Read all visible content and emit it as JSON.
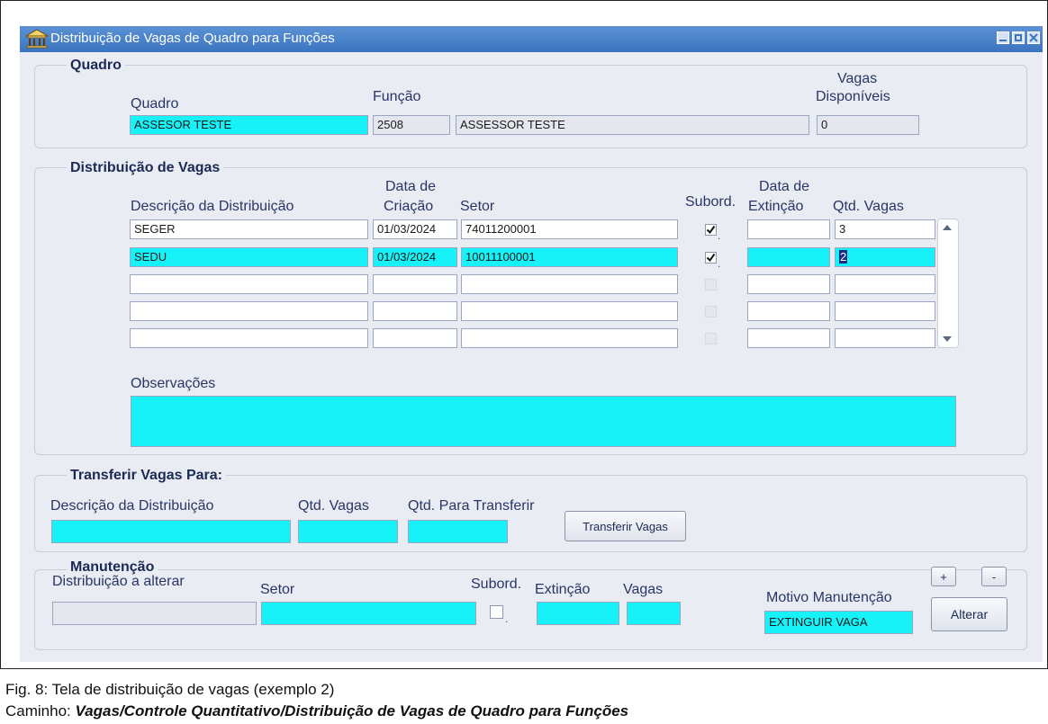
{
  "window": {
    "title": "Distribuição de Vagas de Quadro para Funções"
  },
  "quadro_group": {
    "title": "Quadro",
    "quadro_label": "Quadro",
    "funcao_label": "Função",
    "vagas_label_1": "Vagas",
    "vagas_label_2": "Disponíveis",
    "quadro_value": "ASSESOR TESTE",
    "funcao_code": "2508",
    "funcao_name": "ASSESSOR TESTE",
    "vagas_disponiveis": "0"
  },
  "distribuicao_group": {
    "title": "Distribuição de Vagas",
    "col_descricao": "Descrição da Distribuição",
    "col_data_criacao_1": "Data de",
    "col_data_criacao_2": "Criação",
    "col_setor": "Setor",
    "col_subord": "Subord.",
    "col_data_extincao_1": "Data de",
    "col_data_extincao_2": "Extinção",
    "col_qtd_vagas": "Qtd. Vagas",
    "rows": [
      {
        "descricao": "SEGER",
        "data_criacao": "01/03/2024",
        "setor": "74011200001",
        "subord": true,
        "data_extincao": "",
        "qtd_vagas": "3"
      },
      {
        "descricao": "SEDU",
        "data_criacao": "01/03/2024",
        "setor": "10011100001",
        "subord": true,
        "data_extincao": "",
        "qtd_vagas": "2"
      },
      {
        "descricao": "",
        "data_criacao": "",
        "setor": "",
        "subord": false,
        "data_extincao": "",
        "qtd_vagas": ""
      },
      {
        "descricao": "",
        "data_criacao": "",
        "setor": "",
        "subord": false,
        "data_extincao": "",
        "qtd_vagas": ""
      },
      {
        "descricao": "",
        "data_criacao": "",
        "setor": "",
        "subord": false,
        "data_extincao": "",
        "qtd_vagas": ""
      }
    ],
    "observacoes_label": "Observações",
    "observacoes_value": ""
  },
  "transferir_group": {
    "title": "Transferir Vagas Para:",
    "descricao_label": "Descrição da Distribuição",
    "qtd_vagas_label": "Qtd. Vagas",
    "qtd_transferir_label": "Qtd. Para Transferir",
    "button_label": "Transferir Vagas"
  },
  "manutencao_group": {
    "title": "Manutenção",
    "distribuicao_label": "Distribuição a alterar",
    "setor_label": "Setor",
    "subord_label": "Subord.",
    "extincao_label": "Extinção",
    "vagas_label": "Vagas",
    "motivo_label": "Motivo Manutenção",
    "motivo_value": "EXTINGUIR VAGA",
    "plus_label": "+",
    "minus_label": "-",
    "alterar_label": "Alterar"
  },
  "caption": {
    "line1": "Fig. 8: Tela de distribuição de vagas (exemplo 2)",
    "line2_prefix": "Caminho: ",
    "line2_path": "Vagas/Controle Quantitativo/Distribuição de Vagas de Quadro para Funções"
  },
  "colors": {
    "field_highlight": "#16f2f7",
    "titlebar": "#3b74c0",
    "window_bg": "#e9ecf3"
  }
}
